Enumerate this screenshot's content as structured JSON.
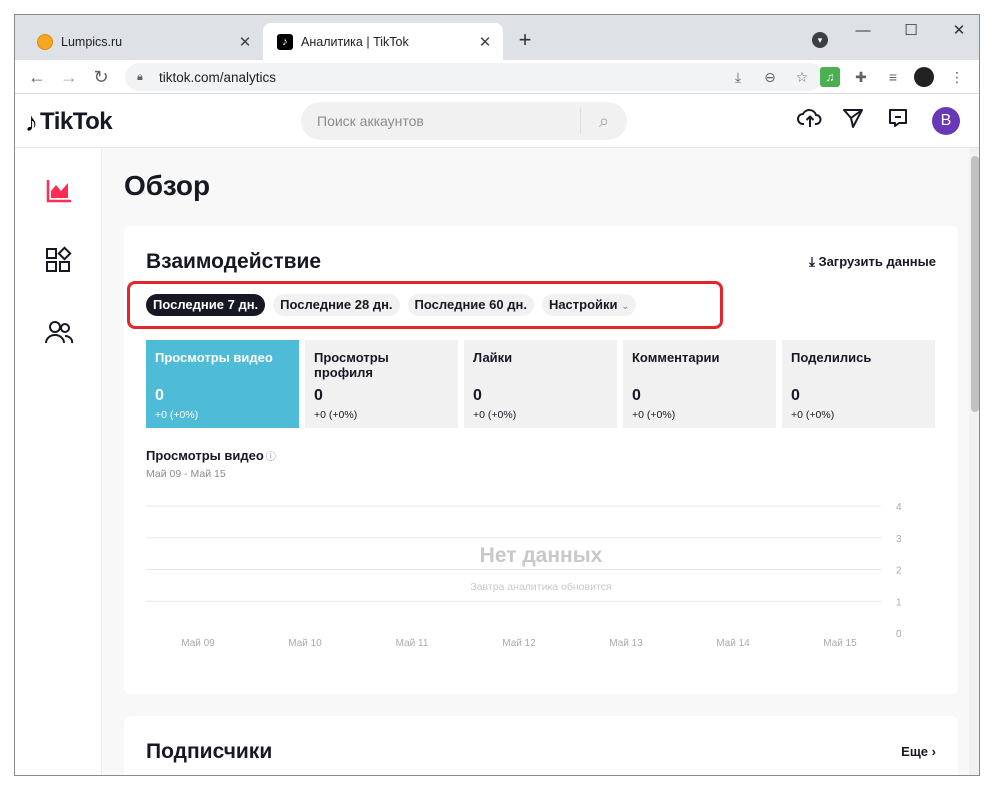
{
  "browser": {
    "tabs": [
      {
        "title": "Lumpics.ru",
        "active": false
      },
      {
        "title": "Аналитика | TikTok",
        "active": true
      }
    ],
    "new_tab": "+",
    "url": "tiktok.com/analytics"
  },
  "header": {
    "logo_text": "TikTok",
    "search_placeholder": "Поиск аккаунтов",
    "avatar_letter": "B"
  },
  "page": {
    "title": "Обзор"
  },
  "engagement": {
    "title": "Взаимодействие",
    "download_label": "Загрузить данные",
    "periods": [
      "Последние 7 дн.",
      "Последние 28 дн.",
      "Последние 60 дн."
    ],
    "settings_label": "Настройки",
    "metrics": [
      {
        "label": "Просмотры видео",
        "value": "0",
        "delta": "+0 (+0%)"
      },
      {
        "label": "Просмотры профиля",
        "value": "0",
        "delta": "+0 (+0%)"
      },
      {
        "label": "Лайки",
        "value": "0",
        "delta": "+0 (+0%)"
      },
      {
        "label": "Комментарии",
        "value": "0",
        "delta": "+0 (+0%)"
      },
      {
        "label": "Поделились",
        "value": "0",
        "delta": "+0 (+0%)"
      }
    ]
  },
  "chart_data": {
    "type": "line",
    "title": "Просмотры видео",
    "subtitle": "Май 09 - Май 15",
    "categories": [
      "Май 09",
      "Май 10",
      "Май 11",
      "Май 12",
      "Май 13",
      "Май 14",
      "Май 15"
    ],
    "y_ticks": [
      "4",
      "3",
      "2",
      "1",
      "0"
    ],
    "ylim": [
      0,
      4
    ],
    "grid": true,
    "empty_title": "Нет данных",
    "empty_subtitle": "Завтра аналитика обновится",
    "series": []
  },
  "followers": {
    "title": "Подписчики",
    "more_label": "Еще"
  }
}
